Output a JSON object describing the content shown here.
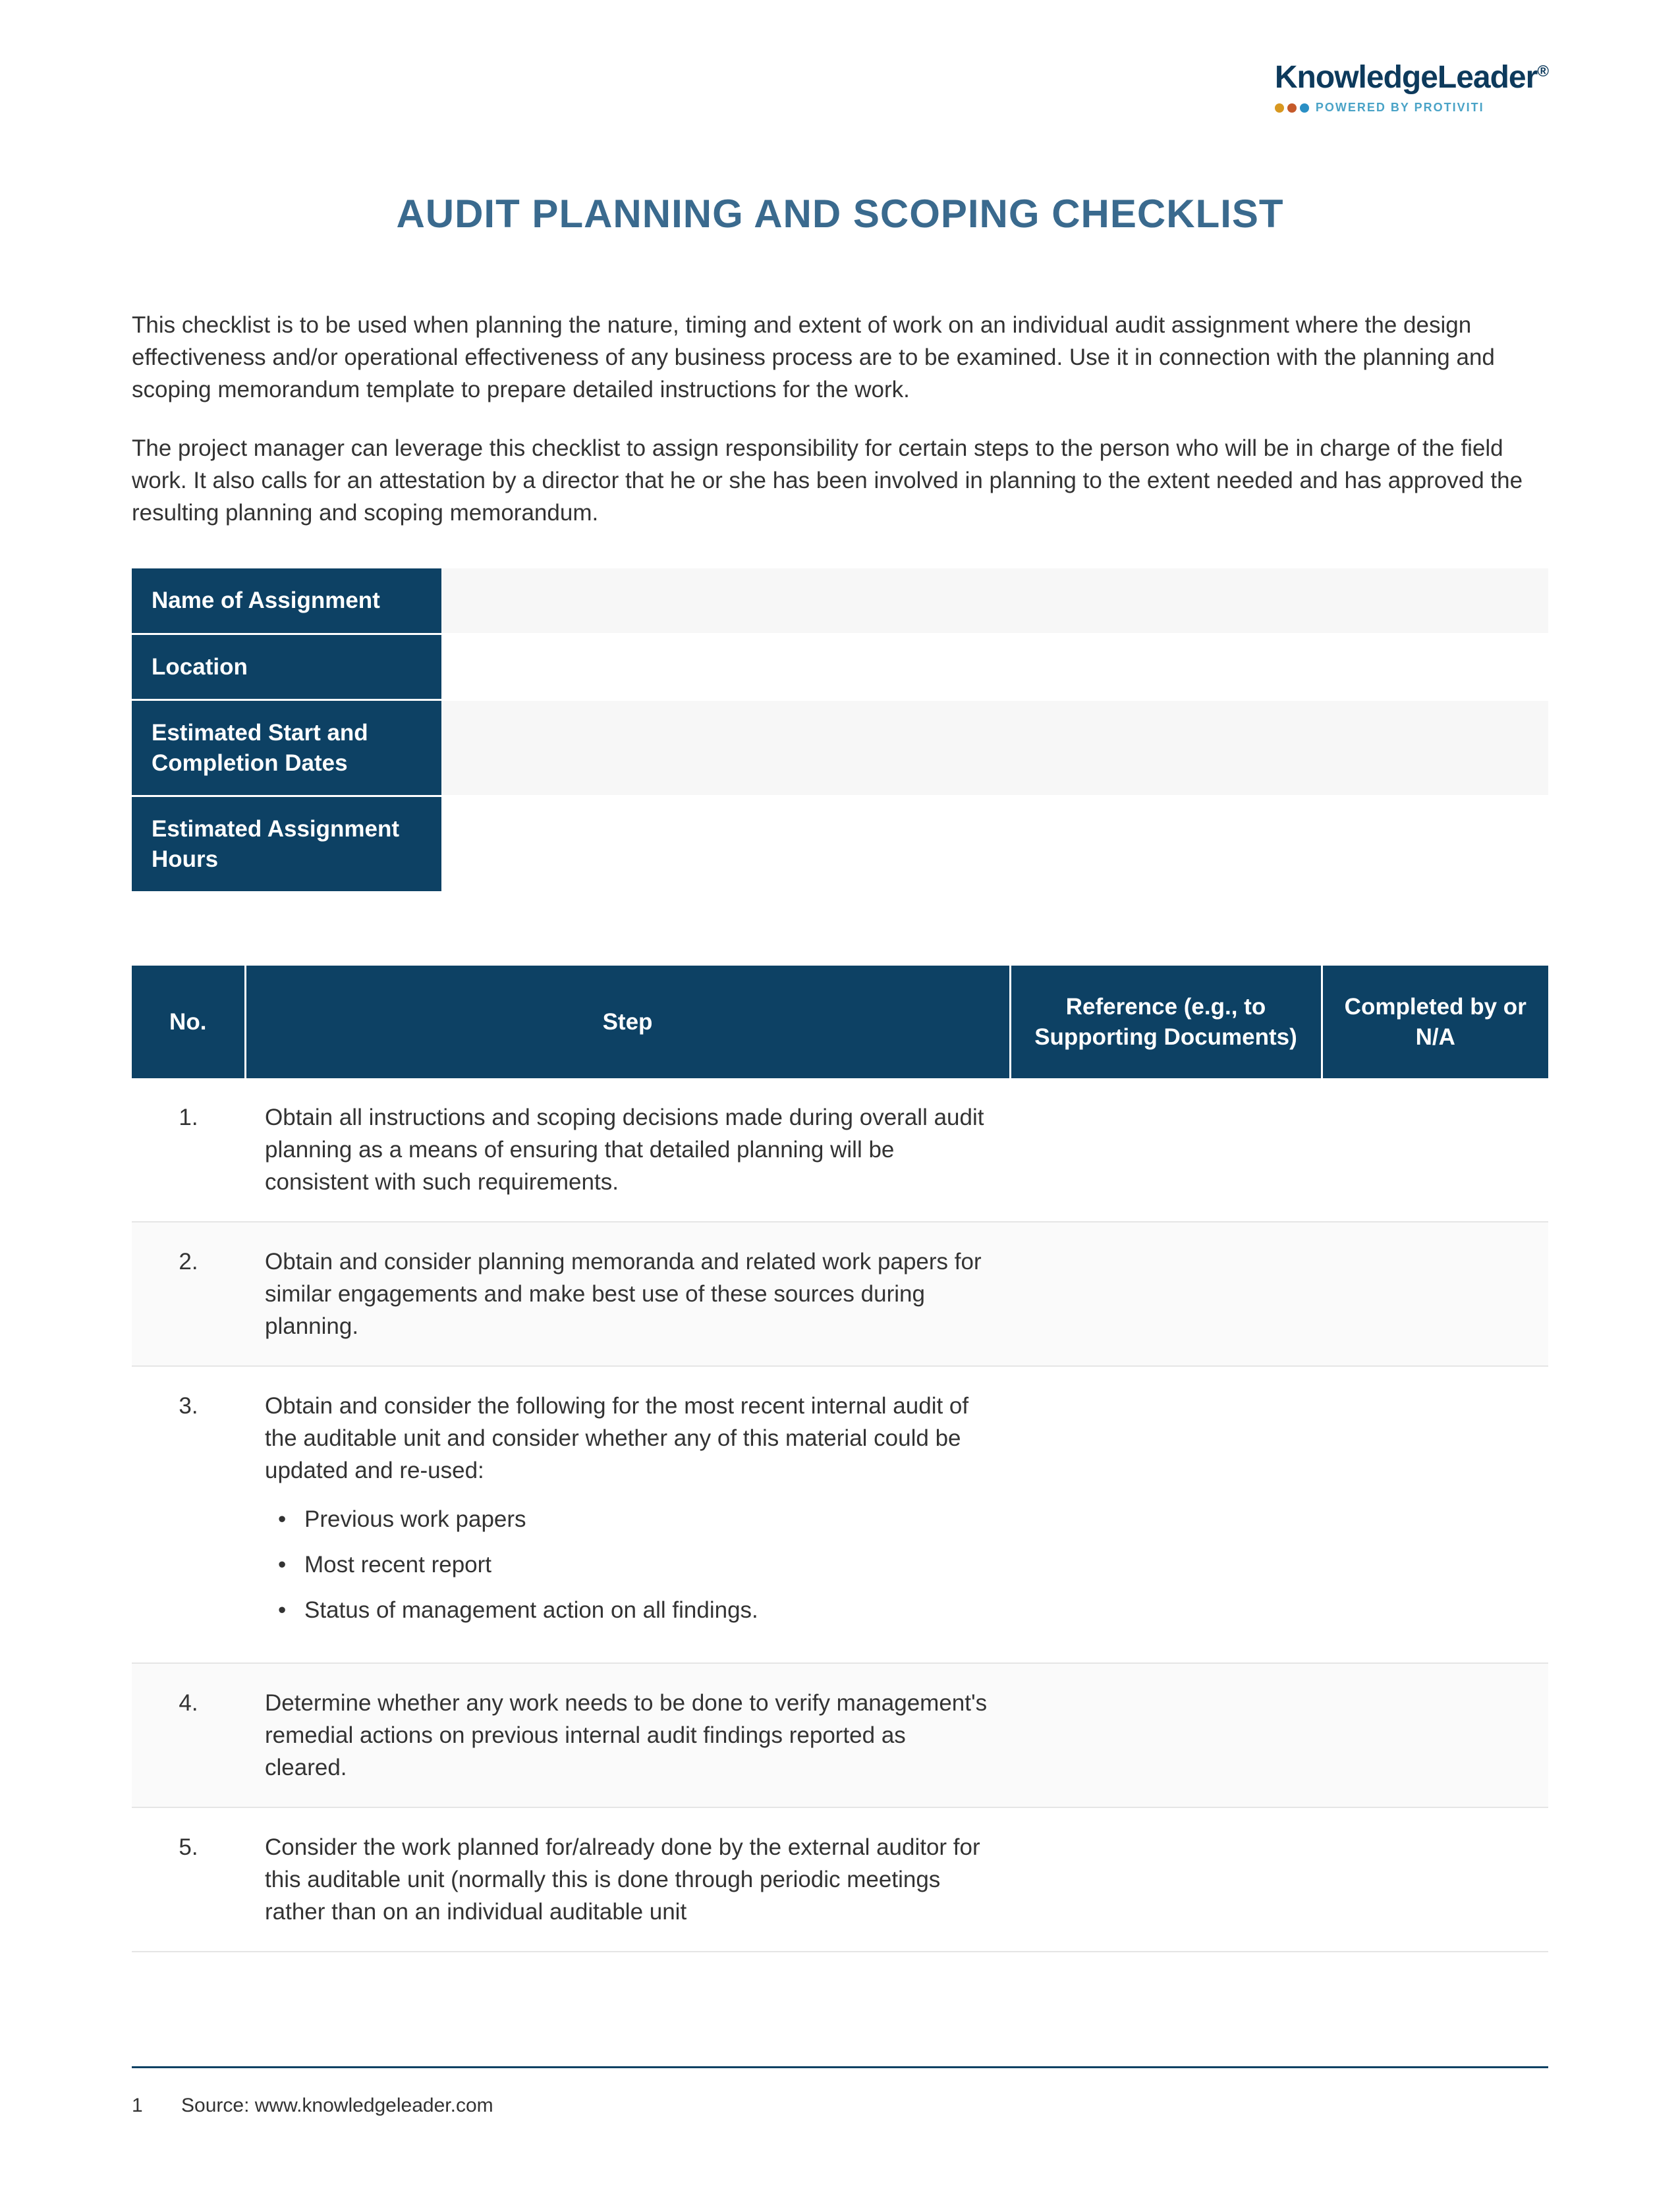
{
  "header": {
    "logo_main": "KnowledgeLeader",
    "logo_reg": "®",
    "logo_powered": "POWERED BY PROTIVITI"
  },
  "title": "AUDIT PLANNING AND SCOPING CHECKLIST",
  "intro": {
    "para1": "This checklist is to be used when planning the nature, timing and extent of work on an individual audit assignment where the design effectiveness and/or operational effectiveness of any business process are to be examined. Use it in connection with the planning and scoping memorandum template to prepare detailed instructions for the work.",
    "para2": "The project manager can leverage this checklist to assign responsibility for certain steps to the person who will be in charge of the field work. It also calls for an attestation by a director that he or she has been involved in planning to the extent needed and has approved the resulting planning and scoping memorandum."
  },
  "info_fields": [
    {
      "label": "Name of Assignment",
      "value": ""
    },
    {
      "label": "Location",
      "value": ""
    },
    {
      "label": "Estimated Start and Completion Dates",
      "value": ""
    },
    {
      "label": "Estimated Assignment Hours",
      "value": ""
    }
  ],
  "checklist": {
    "headers": {
      "no": "No.",
      "step": "Step",
      "reference": "Reference (e.g., to Supporting Documents)",
      "completed": "Completed by or N/A"
    },
    "rows": [
      {
        "no": "1.",
        "step": "Obtain all instructions and scoping decisions made during overall audit planning as a means of ensuring that detailed planning will be consistent with such requirements.",
        "bullets": [],
        "reference": "",
        "completed": ""
      },
      {
        "no": "2.",
        "step": "Obtain and consider planning memoranda and related work papers for similar engagements and make best use of these sources during planning.",
        "bullets": [],
        "reference": "",
        "completed": ""
      },
      {
        "no": "3.",
        "step": "Obtain and consider the following for the most recent internal audit of the auditable unit and consider whether any of this material could be updated and re-used:",
        "bullets": [
          "Previous work papers",
          "Most recent report",
          "Status of management action on all findings."
        ],
        "reference": "",
        "completed": ""
      },
      {
        "no": "4.",
        "step": "Determine whether any work needs to be done to verify management's remedial actions on previous internal audit findings reported as cleared.",
        "bullets": [],
        "reference": "",
        "completed": ""
      },
      {
        "no": "5.",
        "step": "Consider the work planned for/already done by the external auditor for this auditable unit (normally this is done through periodic meetings rather than on an individual auditable unit",
        "bullets": [],
        "reference": "",
        "completed": ""
      }
    ]
  },
  "footer": {
    "page_number": "1",
    "source": "Source: www.knowledgeleader.com"
  }
}
